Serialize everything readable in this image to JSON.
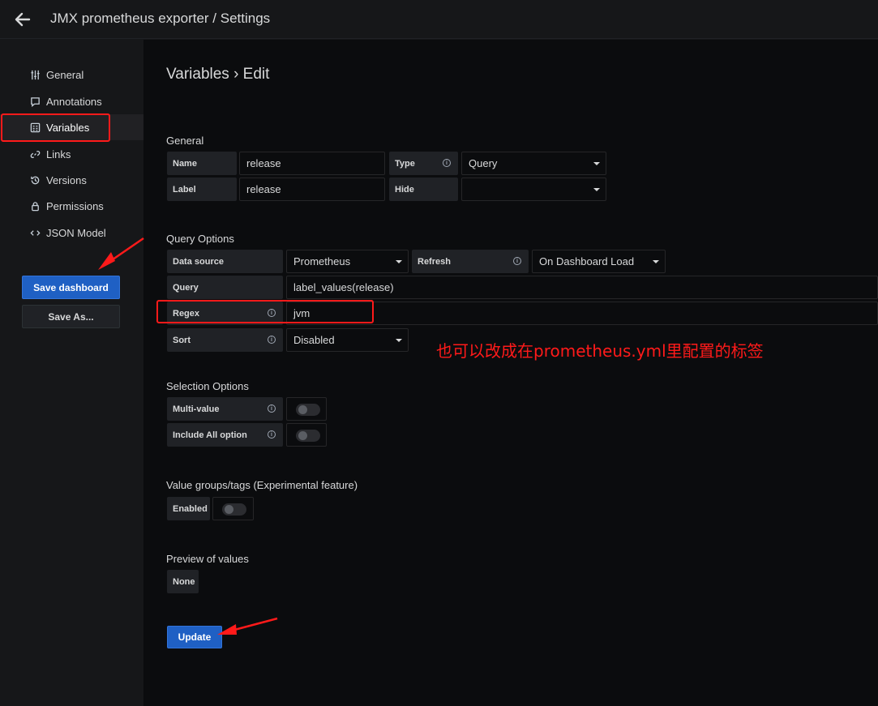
{
  "header": {
    "title": "JMX prometheus exporter / Settings"
  },
  "sidebar": {
    "items": [
      {
        "label": "General",
        "icon": "sliders-icon"
      },
      {
        "label": "Annotations",
        "icon": "comment-icon"
      },
      {
        "label": "Variables",
        "icon": "calculator-icon",
        "active": true
      },
      {
        "label": "Links",
        "icon": "link-icon"
      },
      {
        "label": "Versions",
        "icon": "history-icon"
      },
      {
        "label": "Permissions",
        "icon": "lock-icon"
      },
      {
        "label": "JSON Model",
        "icon": "code-icon"
      }
    ],
    "save_label": "Save dashboard",
    "save_as_label": "Save As..."
  },
  "page": {
    "title": "Variables › Edit"
  },
  "general": {
    "heading": "General",
    "name_label": "Name",
    "name_value": "release",
    "type_label": "Type",
    "type_value": "Query",
    "label_label": "Label",
    "label_value": "release",
    "hide_label": "Hide",
    "hide_value": ""
  },
  "query_options": {
    "heading": "Query Options",
    "datasource_label": "Data source",
    "datasource_value": "Prometheus",
    "refresh_label": "Refresh",
    "refresh_value": "On Dashboard Load",
    "query_label": "Query",
    "query_value": "label_values(release)",
    "regex_label": "Regex",
    "regex_value": "jvm",
    "sort_label": "Sort",
    "sort_value": "Disabled"
  },
  "selection_options": {
    "heading": "Selection Options",
    "multi_label": "Multi-value",
    "multi_value": false,
    "include_all_label": "Include All option",
    "include_all_value": false
  },
  "value_groups": {
    "heading": "Value groups/tags (Experimental feature)",
    "enabled_label": "Enabled",
    "enabled_value": false
  },
  "preview": {
    "heading": "Preview of values",
    "value": "None"
  },
  "update_label": "Update",
  "annotation": {
    "text": "也可以改成在prometheus.yml里配置的标签",
    "color": "#ff1a1a"
  },
  "colors": {
    "primary": "#1f60c4",
    "background": "#0b0c0e",
    "panel": "#161719"
  }
}
